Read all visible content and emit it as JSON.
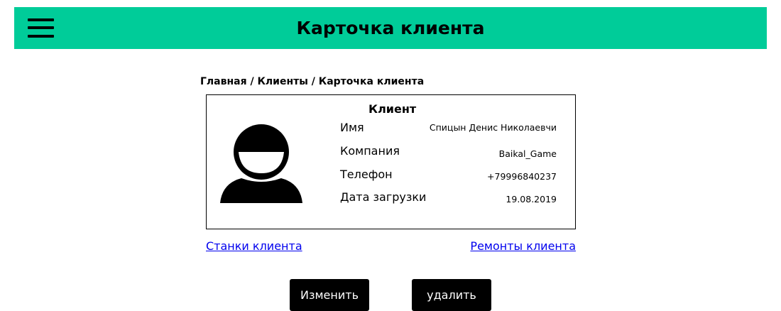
{
  "header": {
    "title": "Карточка клиента",
    "background_color": "#00cc99",
    "menu_icon": "hamburger-menu-icon"
  },
  "breadcrumb": "Главная / Клиенты / Карточка клиента",
  "card": {
    "title": "Клиент",
    "avatar_icon": "user-avatar-icon",
    "fields": [
      {
        "label": "Имя",
        "value": "Спицын Денис Николаевчи"
      },
      {
        "label": "Компания",
        "value": "Baikal_Game"
      },
      {
        "label": "Телефон",
        "value": "+79996840237"
      },
      {
        "label": "Дата загрузки",
        "value": "19.08.2019"
      }
    ]
  },
  "links": {
    "machines": "Станки клиента",
    "repairs": "Ремонты клиента"
  },
  "actions": {
    "edit_label": "Изменить",
    "delete_label": "удалить"
  }
}
